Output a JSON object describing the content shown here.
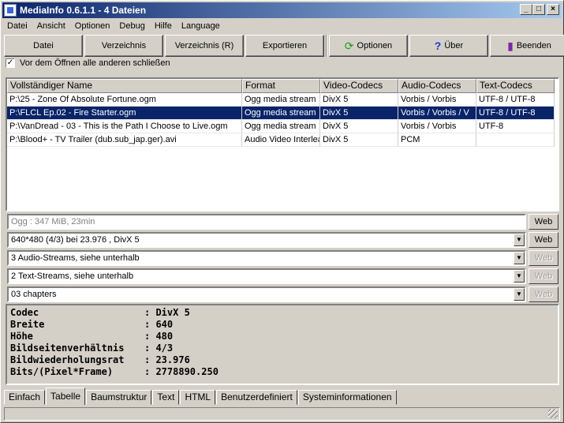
{
  "window": {
    "title": "MediaInfo 0.6.1.1 - 4 Dateien"
  },
  "menu": [
    "Datei",
    "Ansicht",
    "Optionen",
    "Debug",
    "Hilfe",
    "Language"
  ],
  "toolbar": {
    "datei": "Datei",
    "verzeichnis": "Verzeichnis",
    "verzeichnis_r": "Verzeichnis (R)",
    "exportieren": "Exportieren",
    "optionen": "Optionen",
    "ueber": "Über",
    "beenden": "Beenden"
  },
  "close_others": {
    "label": "Vor dem Öffnen alle anderen schließen",
    "checked": true
  },
  "list": {
    "columns": [
      "Vollständiger Name",
      "Format",
      "Video-Codecs",
      "Audio-Codecs",
      "Text-Codecs"
    ],
    "rows": [
      [
        "P:\\25 - Zone Of Absolute Fortune.ogm",
        "Ogg media stream",
        "DivX 5",
        "Vorbis / Vorbis",
        "UTF-8 / UTF-8"
      ],
      [
        "P:\\FLCL Ep.02 - Fire Starter.ogm",
        "Ogg media stream",
        "DivX 5",
        "Vorbis / Vorbis / V",
        "UTF-8 / UTF-8"
      ],
      [
        "P:\\VanDread - 03 - This is the Path I Choose to Live.ogm",
        "Ogg media stream",
        "DivX 5",
        "Vorbis / Vorbis",
        "UTF-8"
      ],
      [
        "P:\\Blood+ - TV Trailer (dub.sub_jap.ger).avi",
        "Audio Video Interleave",
        "DivX 5",
        "PCM",
        ""
      ]
    ],
    "selected_row": 1
  },
  "summary": {
    "general": "Ogg : 347 MiB, 23min",
    "video": "640*480 (4/3) bei 23.976 , DivX 5",
    "audio": "3 Audio-Streams, siehe unterhalb",
    "text": "2 Text-Streams, siehe unterhalb",
    "chapters": "03 chapters",
    "web": "Web"
  },
  "details": [
    {
      "key": "Codec",
      "value": "DivX 5"
    },
    {
      "key": "Breite",
      "value": "640"
    },
    {
      "key": "Höhe",
      "value": "480"
    },
    {
      "key": "Bildseitenverhältnis",
      "value": "4/3"
    },
    {
      "key": "Bildwiederholungsrat",
      "value": "23.976"
    },
    {
      "key": "Bits/(Pixel*Frame)",
      "value": "2778890.250"
    }
  ],
  "tabs": [
    "Einfach",
    "Tabelle",
    "Baumstruktur",
    "Text",
    "HTML",
    "Benutzerdefiniert",
    "Systeminformationen"
  ],
  "active_tab": 1
}
